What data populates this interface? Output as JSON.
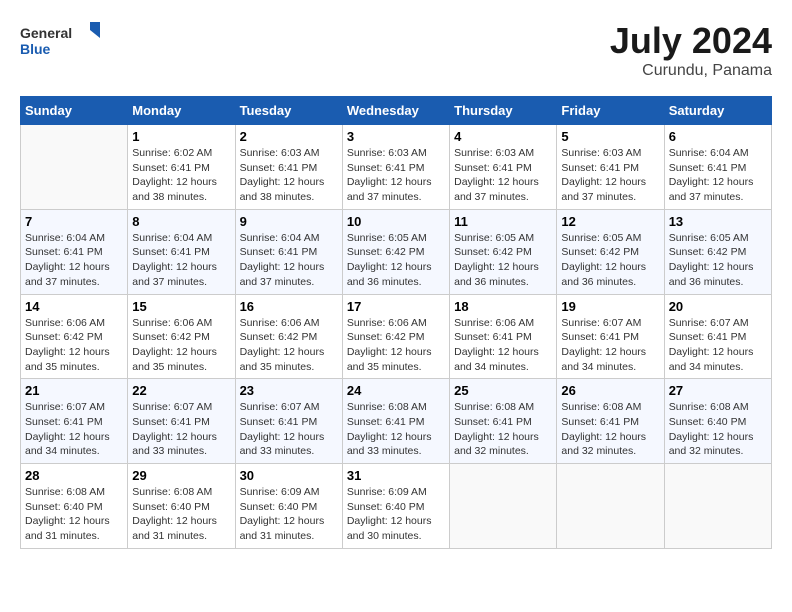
{
  "header": {
    "logo_general": "General",
    "logo_blue": "Blue",
    "month_year": "July 2024",
    "location": "Curundu, Panama"
  },
  "weekdays": [
    "Sunday",
    "Monday",
    "Tuesday",
    "Wednesday",
    "Thursday",
    "Friday",
    "Saturday"
  ],
  "weeks": [
    [
      {
        "day": "",
        "sunrise": "",
        "sunset": "",
        "daylight": ""
      },
      {
        "day": "1",
        "sunrise": "Sunrise: 6:02 AM",
        "sunset": "Sunset: 6:41 PM",
        "daylight": "Daylight: 12 hours and 38 minutes."
      },
      {
        "day": "2",
        "sunrise": "Sunrise: 6:03 AM",
        "sunset": "Sunset: 6:41 PM",
        "daylight": "Daylight: 12 hours and 38 minutes."
      },
      {
        "day": "3",
        "sunrise": "Sunrise: 6:03 AM",
        "sunset": "Sunset: 6:41 PM",
        "daylight": "Daylight: 12 hours and 37 minutes."
      },
      {
        "day": "4",
        "sunrise": "Sunrise: 6:03 AM",
        "sunset": "Sunset: 6:41 PM",
        "daylight": "Daylight: 12 hours and 37 minutes."
      },
      {
        "day": "5",
        "sunrise": "Sunrise: 6:03 AM",
        "sunset": "Sunset: 6:41 PM",
        "daylight": "Daylight: 12 hours and 37 minutes."
      },
      {
        "day": "6",
        "sunrise": "Sunrise: 6:04 AM",
        "sunset": "Sunset: 6:41 PM",
        "daylight": "Daylight: 12 hours and 37 minutes."
      }
    ],
    [
      {
        "day": "7",
        "sunrise": "Sunrise: 6:04 AM",
        "sunset": "Sunset: 6:41 PM",
        "daylight": "Daylight: 12 hours and 37 minutes."
      },
      {
        "day": "8",
        "sunrise": "Sunrise: 6:04 AM",
        "sunset": "Sunset: 6:41 PM",
        "daylight": "Daylight: 12 hours and 37 minutes."
      },
      {
        "day": "9",
        "sunrise": "Sunrise: 6:04 AM",
        "sunset": "Sunset: 6:41 PM",
        "daylight": "Daylight: 12 hours and 37 minutes."
      },
      {
        "day": "10",
        "sunrise": "Sunrise: 6:05 AM",
        "sunset": "Sunset: 6:42 PM",
        "daylight": "Daylight: 12 hours and 36 minutes."
      },
      {
        "day": "11",
        "sunrise": "Sunrise: 6:05 AM",
        "sunset": "Sunset: 6:42 PM",
        "daylight": "Daylight: 12 hours and 36 minutes."
      },
      {
        "day": "12",
        "sunrise": "Sunrise: 6:05 AM",
        "sunset": "Sunset: 6:42 PM",
        "daylight": "Daylight: 12 hours and 36 minutes."
      },
      {
        "day": "13",
        "sunrise": "Sunrise: 6:05 AM",
        "sunset": "Sunset: 6:42 PM",
        "daylight": "Daylight: 12 hours and 36 minutes."
      }
    ],
    [
      {
        "day": "14",
        "sunrise": "Sunrise: 6:06 AM",
        "sunset": "Sunset: 6:42 PM",
        "daylight": "Daylight: 12 hours and 35 minutes."
      },
      {
        "day": "15",
        "sunrise": "Sunrise: 6:06 AM",
        "sunset": "Sunset: 6:42 PM",
        "daylight": "Daylight: 12 hours and 35 minutes."
      },
      {
        "day": "16",
        "sunrise": "Sunrise: 6:06 AM",
        "sunset": "Sunset: 6:42 PM",
        "daylight": "Daylight: 12 hours and 35 minutes."
      },
      {
        "day": "17",
        "sunrise": "Sunrise: 6:06 AM",
        "sunset": "Sunset: 6:42 PM",
        "daylight": "Daylight: 12 hours and 35 minutes."
      },
      {
        "day": "18",
        "sunrise": "Sunrise: 6:06 AM",
        "sunset": "Sunset: 6:41 PM",
        "daylight": "Daylight: 12 hours and 34 minutes."
      },
      {
        "day": "19",
        "sunrise": "Sunrise: 6:07 AM",
        "sunset": "Sunset: 6:41 PM",
        "daylight": "Daylight: 12 hours and 34 minutes."
      },
      {
        "day": "20",
        "sunrise": "Sunrise: 6:07 AM",
        "sunset": "Sunset: 6:41 PM",
        "daylight": "Daylight: 12 hours and 34 minutes."
      }
    ],
    [
      {
        "day": "21",
        "sunrise": "Sunrise: 6:07 AM",
        "sunset": "Sunset: 6:41 PM",
        "daylight": "Daylight: 12 hours and 34 minutes."
      },
      {
        "day": "22",
        "sunrise": "Sunrise: 6:07 AM",
        "sunset": "Sunset: 6:41 PM",
        "daylight": "Daylight: 12 hours and 33 minutes."
      },
      {
        "day": "23",
        "sunrise": "Sunrise: 6:07 AM",
        "sunset": "Sunset: 6:41 PM",
        "daylight": "Daylight: 12 hours and 33 minutes."
      },
      {
        "day": "24",
        "sunrise": "Sunrise: 6:08 AM",
        "sunset": "Sunset: 6:41 PM",
        "daylight": "Daylight: 12 hours and 33 minutes."
      },
      {
        "day": "25",
        "sunrise": "Sunrise: 6:08 AM",
        "sunset": "Sunset: 6:41 PM",
        "daylight": "Daylight: 12 hours and 32 minutes."
      },
      {
        "day": "26",
        "sunrise": "Sunrise: 6:08 AM",
        "sunset": "Sunset: 6:41 PM",
        "daylight": "Daylight: 12 hours and 32 minutes."
      },
      {
        "day": "27",
        "sunrise": "Sunrise: 6:08 AM",
        "sunset": "Sunset: 6:40 PM",
        "daylight": "Daylight: 12 hours and 32 minutes."
      }
    ],
    [
      {
        "day": "28",
        "sunrise": "Sunrise: 6:08 AM",
        "sunset": "Sunset: 6:40 PM",
        "daylight": "Daylight: 12 hours and 31 minutes."
      },
      {
        "day": "29",
        "sunrise": "Sunrise: 6:08 AM",
        "sunset": "Sunset: 6:40 PM",
        "daylight": "Daylight: 12 hours and 31 minutes."
      },
      {
        "day": "30",
        "sunrise": "Sunrise: 6:09 AM",
        "sunset": "Sunset: 6:40 PM",
        "daylight": "Daylight: 12 hours and 31 minutes."
      },
      {
        "day": "31",
        "sunrise": "Sunrise: 6:09 AM",
        "sunset": "Sunset: 6:40 PM",
        "daylight": "Daylight: 12 hours and 30 minutes."
      },
      {
        "day": "",
        "sunrise": "",
        "sunset": "",
        "daylight": ""
      },
      {
        "day": "",
        "sunrise": "",
        "sunset": "",
        "daylight": ""
      },
      {
        "day": "",
        "sunrise": "",
        "sunset": "",
        "daylight": ""
      }
    ]
  ]
}
